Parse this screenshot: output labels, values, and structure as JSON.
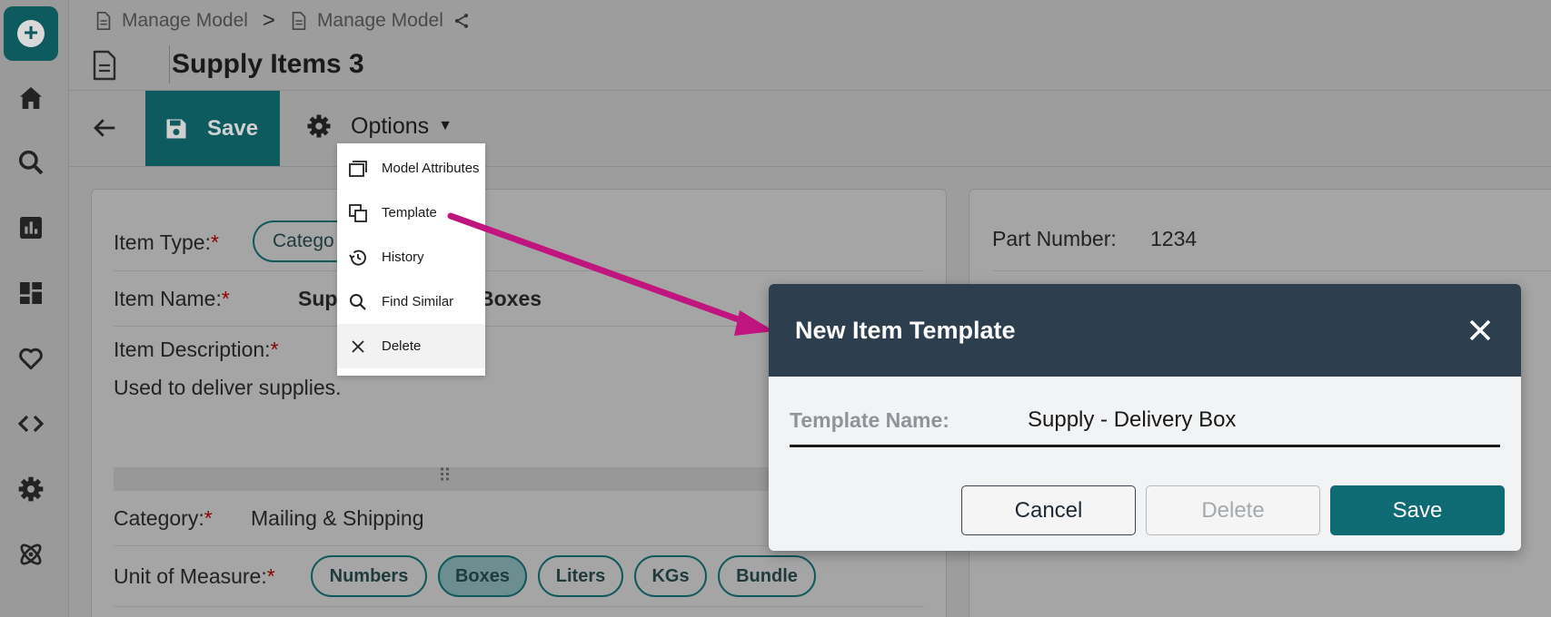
{
  "sidebar": {
    "add_label": "+",
    "icons": [
      "home-icon",
      "search-icon",
      "bar-chart-icon",
      "dashboard-icon",
      "heart-icon",
      "code-icon",
      "gear-icon",
      "atom-icon"
    ]
  },
  "breadcrumb": {
    "first": "Manage Model",
    "separator": ">",
    "second": "Manage Model"
  },
  "page": {
    "title": "Supply Items 3"
  },
  "toolbar": {
    "save_label": "Save",
    "options_label": "Options"
  },
  "options_menu": {
    "items": [
      {
        "label": "Model Attributes",
        "icon": "model-attributes-icon"
      },
      {
        "label": "Template",
        "icon": "template-icon"
      },
      {
        "label": "History",
        "icon": "history-icon"
      },
      {
        "label": "Find Similar",
        "icon": "search-icon"
      },
      {
        "label": "Delete",
        "icon": "close-icon"
      }
    ]
  },
  "form": {
    "item_type_label": "Item Type:",
    "item_type_chip": "Catego",
    "item_name_label": "Item Name:",
    "item_name_left": "Sup",
    "item_name_right": "Boxes",
    "item_description_label": "Item Description:",
    "item_description_value": "Used to deliver supplies.",
    "resize_handle": "⠿",
    "category_label": "Category:",
    "category_value": "Mailing & Shipping",
    "unit_label": "Unit of Measure:",
    "required_mark": "*",
    "units": [
      "Numbers",
      "Boxes",
      "Liters",
      "KGs",
      "Bundle"
    ],
    "selected_unit": "Boxes"
  },
  "right": {
    "part_number_label": "Part Number:",
    "part_number_value": "1234"
  },
  "dialog": {
    "title": "New Item Template",
    "template_name_label": "Template Name:",
    "template_name_value": "Supply - Delivery Box",
    "cancel_label": "Cancel",
    "delete_label": "Delete",
    "save_label": "Save"
  },
  "colors": {
    "teal": "#0d5a5f",
    "dialog_header": "#2d3e4e",
    "save_button": "#0e6b74",
    "arrow": "#c0157f",
    "required": "#8b0000"
  }
}
